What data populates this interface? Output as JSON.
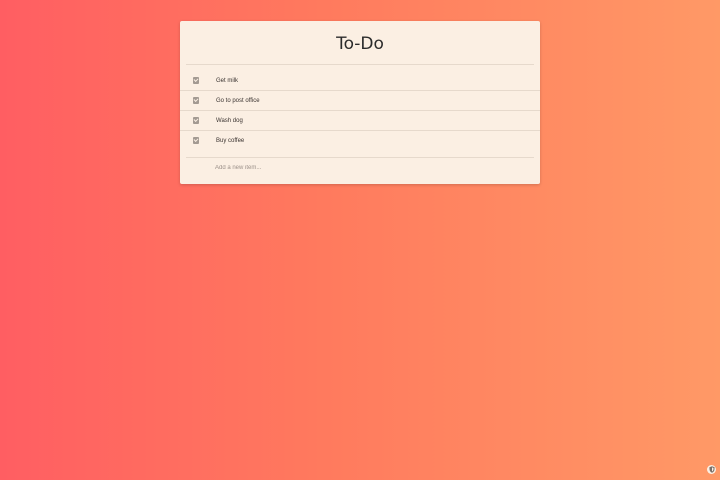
{
  "app": {
    "title": "To-Do"
  },
  "todo": {
    "items": [
      {
        "label": "Get milk",
        "done": true
      },
      {
        "label": "Go to post office",
        "done": true
      },
      {
        "label": "Wash dog",
        "done": true
      },
      {
        "label": "Buy coffee",
        "done": true
      }
    ],
    "new_item": {
      "placeholder": "Add a new item...",
      "value": ""
    }
  },
  "icons": {
    "item_check": "checklist-icon",
    "corner": "shield-icon"
  },
  "colors": {
    "gradient_start": "#ff5e62",
    "gradient_end": "#ff9966",
    "card_background": "#fbefe3",
    "text": "#2b2b2b"
  }
}
